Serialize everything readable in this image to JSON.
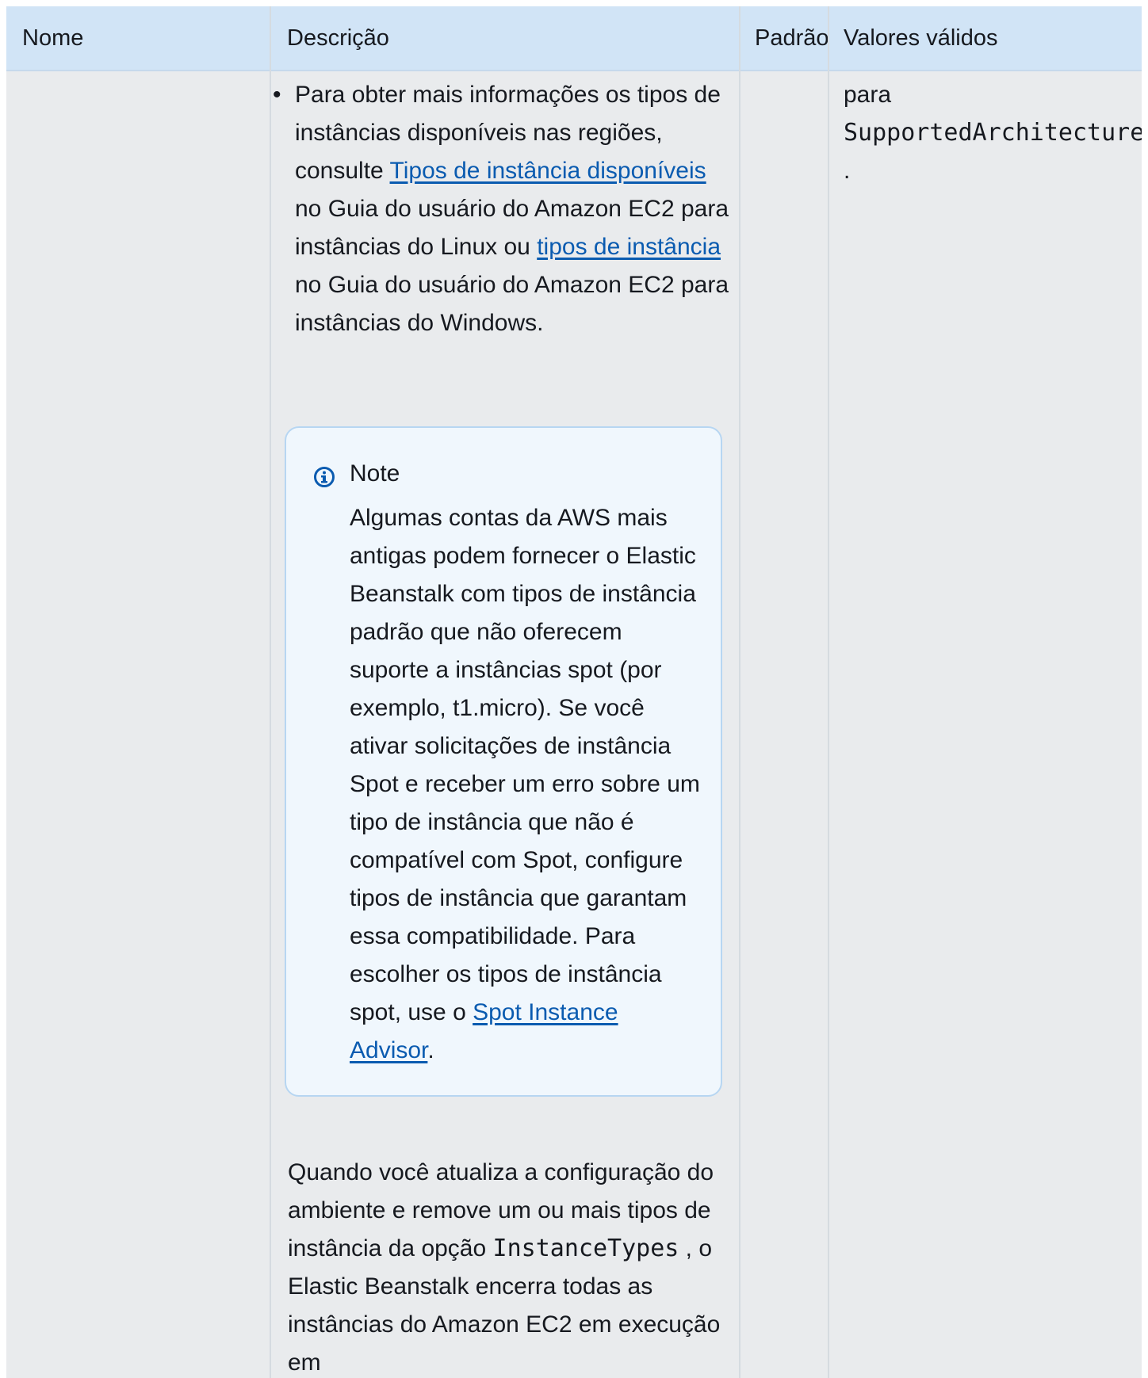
{
  "table": {
    "headers": {
      "name": "Nome",
      "description": "Descrição",
      "default": "Padrão",
      "valid_values": "Valores válidos"
    }
  },
  "description_cell": {
    "bullet": {
      "text_before_link1": "Para obter mais informações os tipos de instâncias disponíveis nas regiões, consulte ",
      "link1": "Tipos de instância disponíveis",
      "text_after_link1": " no Guia do usuário do Amazon EC2 para instâncias do Linux ou ",
      "link2": "tipos de instância",
      "text_after_link2": " no Guia do usuário do Amazon EC2 para instâncias do Windows."
    },
    "note": {
      "title": "Note",
      "icon": "info-icon",
      "body_before_link": "Algumas contas da AWS mais antigas podem fornecer o Elastic Beanstalk com tipos de instância padrão que não oferecem suporte a instâncias spot (por exemplo, t1.micro). Se você ativar solicitações de instância Spot e receber um erro sobre um tipo de instância que não é compatível com Spot, configure tipos de instância que garantam essa compatibilidade. Para escolher os tipos de instância spot, use o ",
      "link": "Spot Instance Advisor",
      "body_after_link": "."
    },
    "paragraph": {
      "text_before_code": "Quando você atualiza a configuração do ambiente e remove um ou mais tipos de instância da opção ",
      "code": "InstanceTypes",
      "text_after_code": " , o Elastic Beanstalk encerra todas as instâncias do Amazon EC2 em execução em"
    }
  },
  "valid_values_cell": {
    "prefix": "para ",
    "code": "SupportedArchitectures",
    "suffix": " ."
  },
  "colors": {
    "header_bg": "#d1e4f6",
    "cell_bg": "#e9ebed",
    "link": "#0a5bb0",
    "note_bg": "#f0f7fd",
    "note_border": "#b7d6f2"
  }
}
